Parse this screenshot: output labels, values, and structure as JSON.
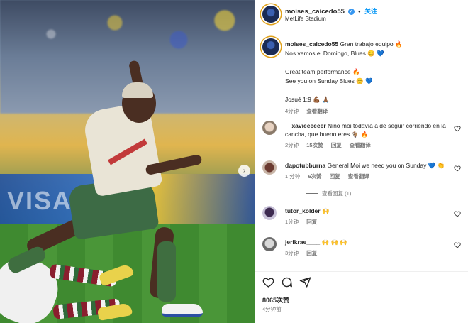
{
  "post": {
    "username": "moises_caicedo55",
    "verified_mark": "✓",
    "separator": "•",
    "follow_label": "关注",
    "location": "MetLife Stadium"
  },
  "caption": {
    "username": "moises_caicedo55",
    "lines": [
      "Gran trabajo equipo 🔥",
      "Nos vemos el Domingo, Blues 😊 💙",
      "",
      "Great team performance 🔥",
      "See you on Sunday Blues 😊 💙",
      "",
      "Josué 1:9 💪🏾 🙏🏾"
    ],
    "time": "4分钟",
    "translate": "查看翻译"
  },
  "comments": [
    {
      "username": "__xavieeeeeer",
      "text_line1": "Niño moi todavía a de seguir corriendo en la",
      "text_line2": "cancha, que bueno eres 🐐 🔥",
      "time": "2分钟",
      "likes": "15次赞",
      "reply": "回复",
      "translate": "查看翻译"
    },
    {
      "username": "dapotubburna",
      "text": "General Moi we need you on Sunday 💙 👏",
      "time": "1 分钟",
      "likes": "6次赞",
      "reply": "回复",
      "translate": "查看翻译",
      "view_replies": "查看回复 (1)"
    },
    {
      "username": "tutor_kolder",
      "text": "🙌",
      "time": "1分钟",
      "reply": "回复"
    },
    {
      "username": "jerikrae____",
      "text": "🙌 🙌 🙌",
      "time": "3分钟",
      "reply": "回复"
    }
  ],
  "photo": {
    "board_text": "VISA"
  },
  "footer": {
    "likes_count": "8065次赞",
    "time": "4分钟前"
  },
  "icons": {
    "like": "heart-icon",
    "comment": "comment-icon",
    "share": "share-icon",
    "next": "chevron-right-icon"
  }
}
